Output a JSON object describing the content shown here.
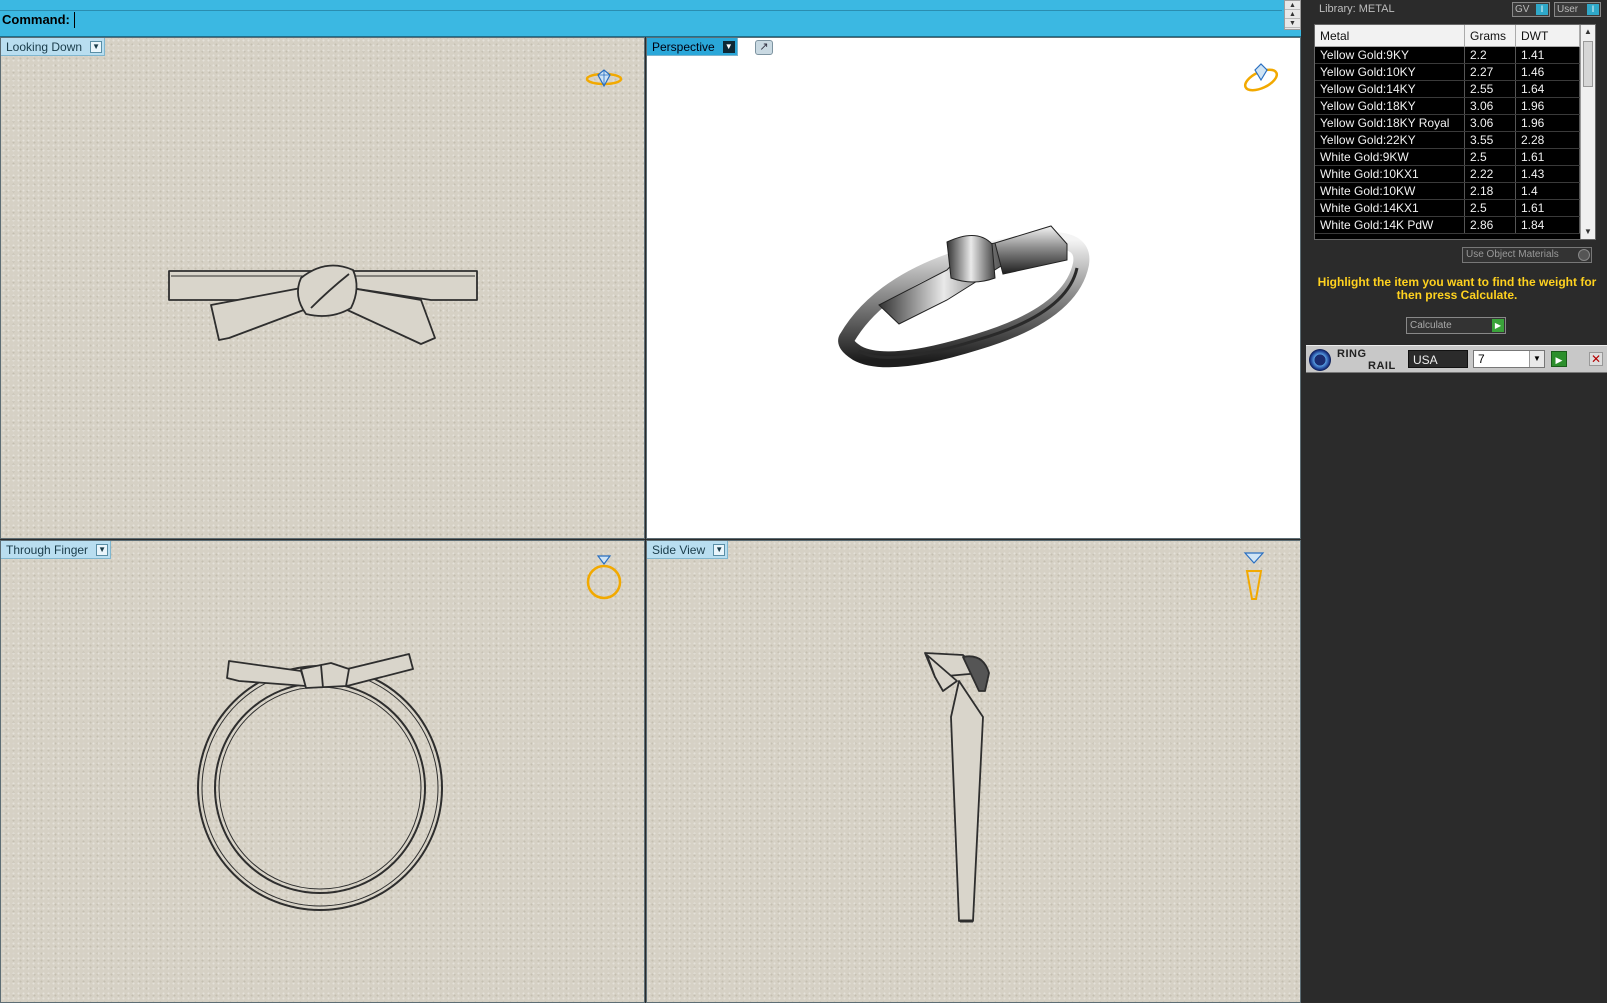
{
  "command_bar": {
    "label": "Command:",
    "value": ""
  },
  "viewports": {
    "top_left": {
      "name": "Looking Down"
    },
    "top_right": {
      "name": "Perspective"
    },
    "bottom_left": {
      "name": "Through Finger"
    },
    "bottom_right": {
      "name": "Side View"
    }
  },
  "panel": {
    "library_title": "Library: METAL",
    "toggles": {
      "gv": "GV",
      "user": "User"
    },
    "table": {
      "headers": [
        "Metal",
        "Grams",
        "DWT"
      ],
      "rows": [
        [
          "Yellow Gold:9KY",
          "2.2",
          "1.41"
        ],
        [
          "Yellow Gold:10KY",
          "2.27",
          "1.46"
        ],
        [
          "Yellow Gold:14KY",
          "2.55",
          "1.64"
        ],
        [
          "Yellow Gold:18KY",
          "3.06",
          "1.96"
        ],
        [
          "Yellow Gold:18KY Royal",
          "3.06",
          "1.96"
        ],
        [
          "Yellow Gold:22KY",
          "3.55",
          "2.28"
        ],
        [
          "White Gold:9KW",
          "2.5",
          "1.61"
        ],
        [
          "White Gold:10KX1",
          "2.22",
          "1.43"
        ],
        [
          "White Gold:10KW",
          "2.18",
          "1.4"
        ],
        [
          "White Gold:14KX1",
          "2.5",
          "1.61"
        ],
        [
          "White Gold:14K PdW",
          "2.86",
          "1.84"
        ]
      ]
    },
    "use_object_materials": "Use Object Materials",
    "hint": "Highlight the item you want to find the weight for then press Calculate.",
    "calculate_label": "Calculate",
    "ring_rail": {
      "title_line1": "RING",
      "title_line2": "RAIL",
      "country": "USA",
      "size": "7"
    }
  },
  "colors": {
    "command_bar": "#3bb8e2",
    "panel_bg": "#2b2b2b",
    "hint": "#ffd21f",
    "gizmo": "#f2a900"
  }
}
